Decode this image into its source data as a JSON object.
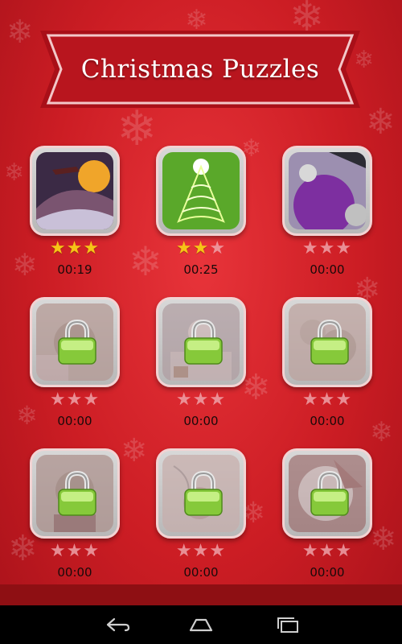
{
  "app": {
    "title": "Christmas Puzzles"
  },
  "colors": {
    "background": "#cc1d24",
    "banner": "#b3131c",
    "star_filled": "#f6c417",
    "star_empty": "#f0aab0",
    "lock": "#8fd13a"
  },
  "levels": [
    {
      "time": "00:19",
      "stars": 3,
      "locked": false,
      "picture": "santa-sleigh-moon"
    },
    {
      "time": "00:25",
      "stars": 2,
      "locked": false,
      "picture": "glowing-christmas-tree"
    },
    {
      "time": "00:00",
      "stars": 0,
      "locked": false,
      "picture": "purple-ornaments"
    },
    {
      "time": "00:00",
      "stars": 0,
      "locked": true,
      "picture": "teddy-bear"
    },
    {
      "time": "00:00",
      "stars": 0,
      "locked": true,
      "picture": "snowman"
    },
    {
      "time": "00:00",
      "stars": 0,
      "locked": true,
      "picture": "teddy-bears"
    },
    {
      "time": "00:00",
      "stars": 0,
      "locked": true,
      "picture": "teddy-with-hat"
    },
    {
      "time": "00:00",
      "stars": 0,
      "locked": true,
      "picture": "santa-drawing"
    },
    {
      "time": "00:00",
      "stars": 0,
      "locked": true,
      "picture": "santa-moon"
    }
  ],
  "navbar": {
    "back_icon": "back-arrow-icon",
    "home_icon": "home-icon",
    "recents_icon": "recent-apps-icon"
  }
}
